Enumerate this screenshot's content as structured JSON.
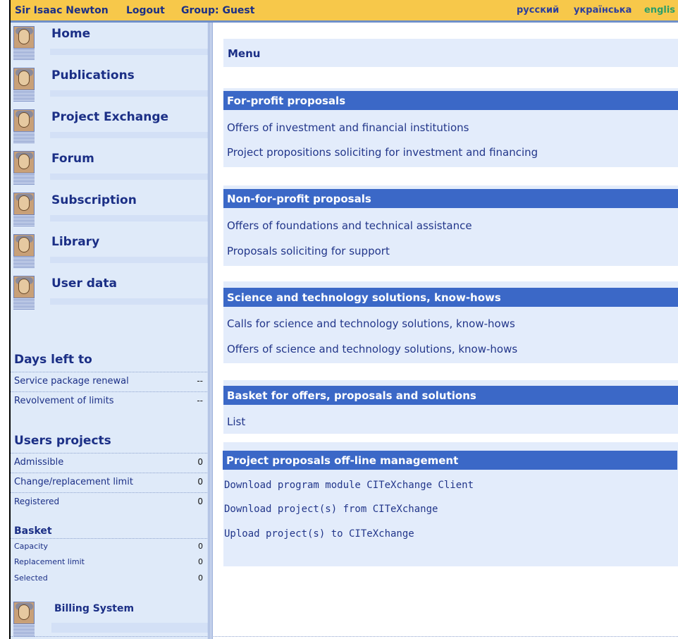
{
  "topbar": {
    "user": "Sir Isaac Newton",
    "logout": "Logout",
    "group": "Group: Guest",
    "lang_ru": "русский",
    "lang_uk": "українська",
    "lang_en": "englis"
  },
  "sidebar": {
    "nav": [
      "Home",
      "Publications",
      "Project Exchange",
      "Forum",
      "Subscription",
      "Library",
      "User data"
    ],
    "days_left_title": "Days left to",
    "days_left": [
      {
        "label": "Service package renewal",
        "value": "--"
      },
      {
        "label": "Revolvement of limits",
        "value": "--"
      }
    ],
    "users_projects_title": "Users projects",
    "users_projects": [
      {
        "label": "Admissible",
        "value": "0"
      },
      {
        "label": "Change/replacement limit",
        "value": "0"
      },
      {
        "label": "Registered",
        "value": "0"
      }
    ],
    "basket_title": "Basket",
    "basket": [
      {
        "label": "Capacity",
        "value": "0"
      },
      {
        "label": "Replacement limit",
        "value": "0"
      },
      {
        "label": "Selected",
        "value": "0"
      }
    ],
    "billing": "Billing System"
  },
  "main": {
    "menu_title": "Menu",
    "sections": [
      {
        "title": "For-profit proposals",
        "links": [
          "Offers of investment and financial institutions",
          "Project propositions soliciting for investment and financing"
        ]
      },
      {
        "title": "Non-for-profit proposals",
        "links": [
          "Offers of foundations and technical assistance",
          "Proposals soliciting for support"
        ]
      },
      {
        "title": "Science and technology solutions, know-hows",
        "links": [
          "Calls for science and technology solutions, know-hows",
          "Offers of science and technology solutions, know-hows"
        ]
      },
      {
        "title": "Basket for offers, proposals and solutions",
        "links": [
          "List"
        ]
      },
      {
        "title": "Project proposals off-line management",
        "links": [
          "Download program module CITeXchange Client",
          "Download project(s) from CITeXchange",
          "Upload project(s) to CITeXchange"
        ]
      }
    ]
  },
  "colors": {
    "topbar": "#f7c84a",
    "section_bar": "#3b68c7",
    "panel": "#e3ecfb",
    "text": "#1b2f86"
  }
}
